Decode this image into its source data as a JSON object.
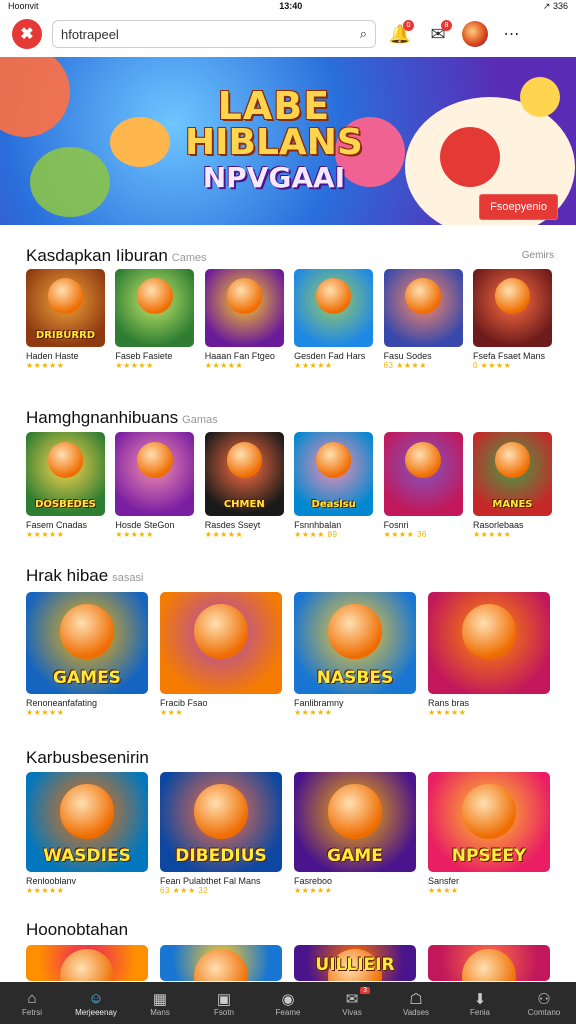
{
  "status": {
    "left": "Hoonvit",
    "time": "13:40",
    "right": "↗ 336"
  },
  "search": {
    "value": "hfotrapeel"
  },
  "topbar": {
    "notif_badge": "0",
    "chat_badge": "8"
  },
  "banner": {
    "line1": "LABE",
    "line2": "HIBLANS",
    "line3": "NPVGAAI",
    "button": "Fsoepyenio"
  },
  "sections": [
    {
      "title": "Kasdapkan Iiburan",
      "sub": "Cames",
      "see_all": "Gemirs",
      "items": [
        {
          "name": "Haden Haste",
          "stars": "★★★★★",
          "thumb_label": "DRIBURRD",
          "colors": [
            "#8e3b12",
            "#f4a33a"
          ]
        },
        {
          "name": "Faseb Fasiete",
          "stars": "★★★★★",
          "thumb_label": "",
          "colors": [
            "#2e7d32",
            "#c6e86b"
          ]
        },
        {
          "name": "Haaan Fan Ftgeo",
          "stars": "★★★★★",
          "thumb_label": "",
          "colors": [
            "#6a1b9a",
            "#ffca28"
          ]
        },
        {
          "name": "Gesden Fad Hars",
          "stars": "★★★★★",
          "thumb_label": "",
          "colors": [
            "#1e88e5",
            "#9ccc65"
          ]
        },
        {
          "name": "Fasu Sodes",
          "stars": "63 ★★★★",
          "thumb_label": "",
          "colors": [
            "#3949ab",
            "#ff8a65"
          ]
        },
        {
          "name": "Fsefa Fsaet Mans",
          "stars": "0 ★★★★",
          "thumb_label": "",
          "colors": [
            "#6d1b1b",
            "#ff7043"
          ]
        }
      ]
    },
    {
      "title": "Hamghgnanhibuans",
      "sub": "Gamas",
      "see_all": "",
      "items": [
        {
          "name": "Fasem Cnadas",
          "stars": "★★★★★",
          "thumb_label": "DOSBEDES",
          "colors": [
            "#2e7d32",
            "#ffd54f"
          ]
        },
        {
          "name": "Hosde SteGon",
          "stars": "★★★★★",
          "thumb_label": "",
          "colors": [
            "#7b1fa2",
            "#f48fb1"
          ]
        },
        {
          "name": "Rasdes Sseyt",
          "stars": "★★★★★",
          "thumb_label": "CHMEN",
          "colors": [
            "#1a1a1a",
            "#ff7043"
          ]
        },
        {
          "name": "Fsnnhbalan",
          "stars": "★★★★ 89",
          "thumb_label": "Deaslsu",
          "colors": [
            "#0288d1",
            "#f48fb1"
          ]
        },
        {
          "name": "Fosnri",
          "stars": "★★★★ 36",
          "thumb_label": "",
          "colors": [
            "#c2185b",
            "#7e57c2"
          ]
        },
        {
          "name": "Rasorlebaas",
          "stars": "★★★★★",
          "thumb_label": "MANES",
          "colors": [
            "#c62828",
            "#43a047"
          ]
        }
      ]
    },
    {
      "title": "Hrak hibae",
      "sub": "sasasi",
      "see_all": "",
      "items": [
        {
          "name": "Renoneanfafating",
          "stars": "★★★★★",
          "thumb_label": "GAMES",
          "colors": [
            "#1565c0",
            "#ffb300"
          ]
        },
        {
          "name": "Fracib Fsao",
          "stars": "★★★",
          "thumb_label": "",
          "colors": [
            "#f57c00",
            "#ab47bc"
          ]
        },
        {
          "name": "Fanlibramny",
          "stars": "★★★★★",
          "thumb_label": "NASBES",
          "colors": [
            "#1976d2",
            "#ffca28"
          ]
        },
        {
          "name": "Rans bras",
          "stars": "★★★★★",
          "thumb_label": "",
          "colors": [
            "#c2185b",
            "#ff8f00"
          ]
        }
      ]
    },
    {
      "title": "Karbusbesenirin",
      "sub": "",
      "see_all": "",
      "items": [
        {
          "name": "Renlooblanv",
          "stars": "★★★★★",
          "thumb_label": "WASDIES",
          "colors": [
            "#0277bd",
            "#ff6f00"
          ]
        },
        {
          "name": "Fean Pulabthet Fal Mans",
          "stars": "63 ★★★ 32",
          "thumb_label": "DIBEDIUS",
          "colors": [
            "#0d47a1",
            "#ff7043"
          ]
        },
        {
          "name": "Fasreboo",
          "stars": "★★★★★",
          "thumb_label": "GAME",
          "colors": [
            "#4a148c",
            "#ffb300"
          ]
        },
        {
          "name": "Sansfer",
          "stars": "★★★★",
          "thumb_label": "NPSEEY",
          "colors": [
            "#e91e63",
            "#ffca28"
          ]
        }
      ]
    },
    {
      "title": "Hoonobtahan",
      "sub": "",
      "see_all": "",
      "items": [
        {
          "name": "",
          "stars": "",
          "thumb_label": "",
          "colors": [
            "#ff8f00",
            "#e91e63"
          ]
        },
        {
          "name": "",
          "stars": "",
          "thumb_label": "",
          "colors": [
            "#1976d2",
            "#ffca28"
          ]
        },
        {
          "name": "",
          "stars": "",
          "thumb_label": "UILLIEIR",
          "colors": [
            "#4a148c",
            "#ff6f00"
          ]
        },
        {
          "name": "",
          "stars": "",
          "thumb_label": "",
          "colors": [
            "#c2185b",
            "#ff7043"
          ]
        }
      ]
    }
  ],
  "nav": [
    {
      "label": "Fetrsi",
      "icon": "home-icon",
      "glyph": "⌂"
    },
    {
      "label": "Merjeeenay",
      "icon": "user-icon",
      "glyph": "☺",
      "active": true
    },
    {
      "label": "Mans",
      "icon": "grid-icon",
      "glyph": "▦"
    },
    {
      "label": "Fsotn",
      "icon": "folder-icon",
      "glyph": "▣"
    },
    {
      "label": "Feame",
      "icon": "circle-icon",
      "glyph": "◉"
    },
    {
      "label": "Vivas",
      "icon": "mail-icon",
      "glyph": "✉",
      "badge": "3"
    },
    {
      "label": "Vadses",
      "icon": "store-icon",
      "glyph": "☖"
    },
    {
      "label": "Fenia",
      "icon": "download-icon",
      "glyph": "⬇"
    },
    {
      "label": "Comtano",
      "icon": "profile-icon",
      "glyph": "⚇"
    }
  ]
}
